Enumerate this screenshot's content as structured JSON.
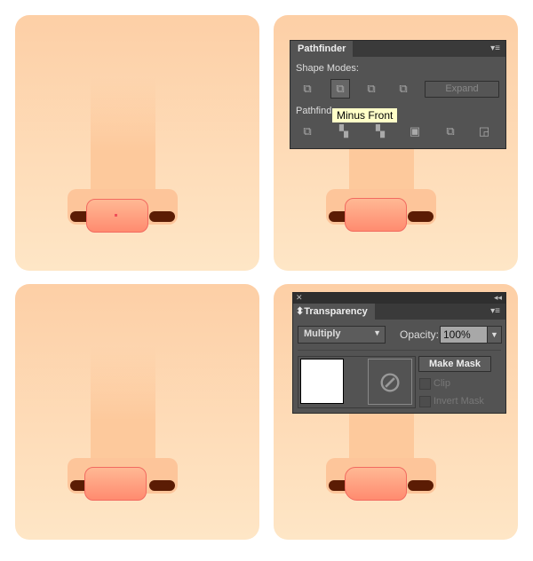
{
  "pathfinder": {
    "title": "Pathfinder",
    "shape_modes_label": "Shape Modes:",
    "pathfinders_label": "Pathfind",
    "expand_label": "Expand",
    "tooltip": "Minus Front",
    "shape_mode_icons": [
      "unite-icon",
      "minus-front-icon",
      "intersect-icon",
      "exclude-icon"
    ],
    "pathfinder_icons": [
      "divide-icon",
      "trim-icon",
      "merge-icon",
      "crop-icon",
      "outline-icon",
      "minus-back-icon"
    ]
  },
  "transparency": {
    "title": "Transparency",
    "blend_mode": "Multiply",
    "opacity_label": "Opacity:",
    "opacity_value": "100%",
    "make_mask_label": "Make Mask",
    "clip_label": "Clip",
    "invert_mask_label": "Invert Mask",
    "clip_checked": false,
    "invert_checked": false
  },
  "colors": {
    "background_top": "#fdcfa6",
    "background_bottom": "#fee6c6",
    "nostril": "#5b1c04",
    "tip_top": "#ffb894",
    "tip_bottom": "#ff8b70",
    "panel": "#535353"
  }
}
